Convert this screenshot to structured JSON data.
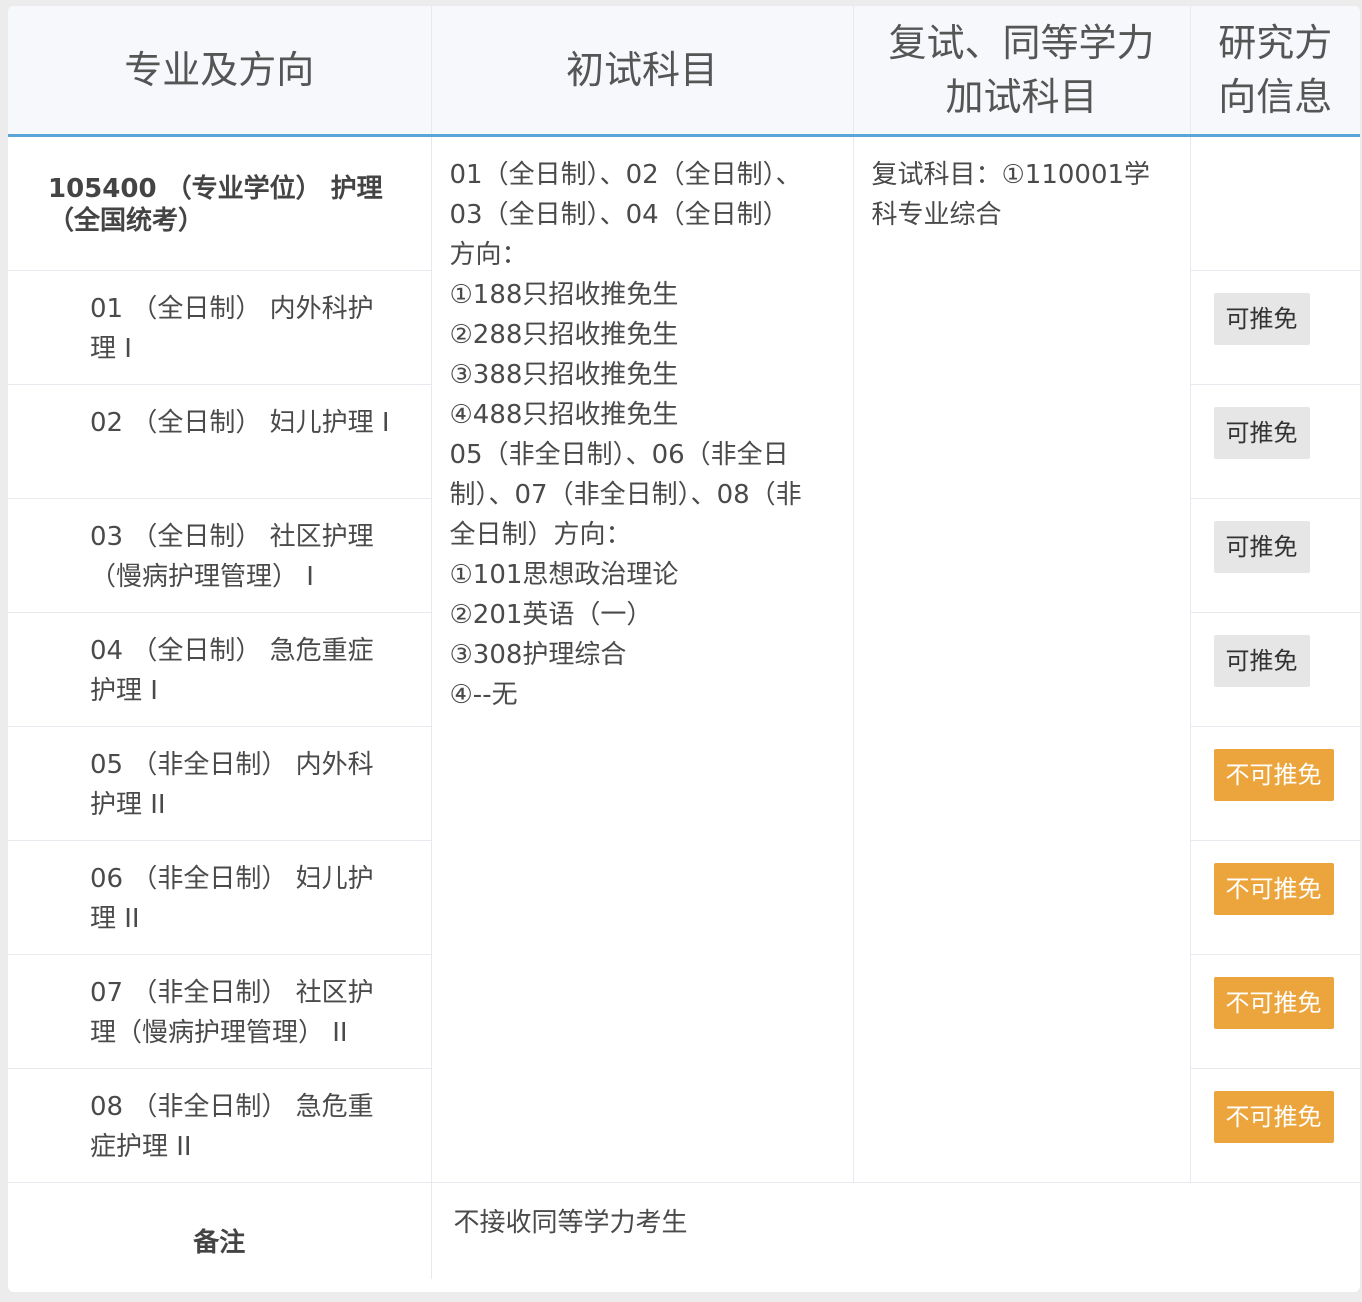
{
  "header": {
    "col1": "专业及方向",
    "col2": "初试科目",
    "col3_line1": "复试、同等学力",
    "col3_line2": "加试科目",
    "col4_line1": "研究方",
    "col4_line2": "向信息"
  },
  "major": {
    "name": "105400 （专业学位） 护理 （全国统考）"
  },
  "directions": [
    {
      "name": "01 （全日制） 内外科护理 I",
      "badge": "可推免",
      "recommendable": true
    },
    {
      "name": "02 （全日制） 妇儿护理 I",
      "badge": "可推免",
      "recommendable": true
    },
    {
      "name": "03 （全日制） 社区护理（慢病护理管理） I",
      "badge": "可推免",
      "recommendable": true
    },
    {
      "name": "04 （全日制） 急危重症护理 I",
      "badge": "可推免",
      "recommendable": true
    },
    {
      "name": "05 （非全日制） 内外科护理 II",
      "badge": "不可推免",
      "recommendable": false
    },
    {
      "name": "06 （非全日制） 妇儿护理 II",
      "badge": "不可推免",
      "recommendable": false
    },
    {
      "name": "07 （非全日制） 社区护理（慢病护理管理） II",
      "badge": "不可推免",
      "recommendable": false
    },
    {
      "name": "08 （非全日制） 急危重症护理 II",
      "badge": "不可推免",
      "recommendable": false
    }
  ],
  "exam_subjects": {
    "lines": [
      "01（全日制）、02（全日制）、",
      "03（全日制）、04（全日制）",
      "方向：",
      "①188只招收推免生",
      "②288只招收推免生",
      "③388只招收推免生",
      "④488只招收推免生",
      "05（非全日制）、06（非全日",
      "制）、07（非全日制）、08（非",
      "全日制）方向：",
      "①101思想政治理论",
      "②201英语（一）",
      "③308护理综合",
      "④--无"
    ]
  },
  "retest": {
    "text": "复试科目：①110001学科专业综合"
  },
  "note": {
    "label": "备注",
    "text": "不接收同等学力考生"
  },
  "colors": {
    "header_bg": "#f6f8fb",
    "header_border": "#5aa4d8",
    "badge_yes_bg": "#e6e6e6",
    "badge_no_bg": "#eca53c"
  }
}
